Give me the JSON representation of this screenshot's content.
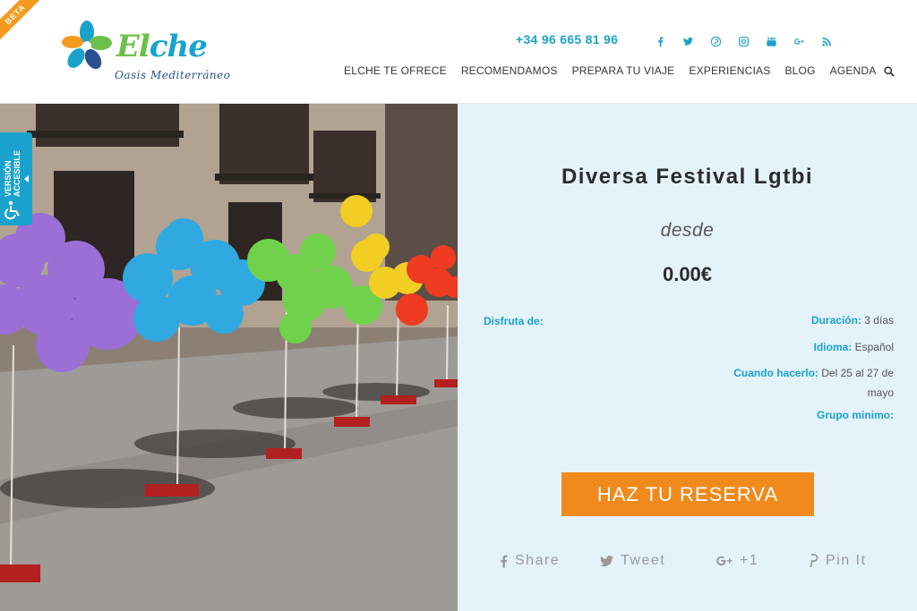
{
  "badge": "BETA",
  "brand": {
    "name_part1": "El",
    "name_part2": "che",
    "tagline": "Oasis Mediterráneo"
  },
  "header": {
    "phone": "+34 96 665 81 96",
    "socials": [
      "facebook-icon",
      "twitter-icon",
      "pinterest-icon",
      "instagram-icon",
      "youtube-icon",
      "google-plus-icon",
      "rss-icon"
    ],
    "nav": [
      "ELCHE TE OFRECE",
      "RECOMENDAMOS",
      "PREPARA TU VIAJE",
      "EXPERIENCIAS",
      "BLOG",
      "AGENDA"
    ]
  },
  "accessible_tab": {
    "label_line1": "VERSIÓN",
    "label_line2": "ACCESIBLE"
  },
  "event": {
    "title": "Diversa Festival Lgtbi",
    "from_label": "desde",
    "price": "0.00€",
    "enjoy_label": "Disfruta de:",
    "duration_label": "Duración:",
    "duration_value": "3 días",
    "language_label": "Idioma:",
    "language_value": "Español",
    "when_label": "Cuando hacerlo:",
    "when_value": "Del 25 al 27 de mayo",
    "group_label": "Grupo minimo:",
    "reserve_button": "HAZ TU RESERVA"
  },
  "share": {
    "facebook": "Share",
    "twitter": "Tweet",
    "gplus": "+1",
    "pinterest": "Pin It"
  },
  "colors": {
    "accent_blue": "#1aa2cc",
    "reserve_orange": "#f08a1c",
    "panel_bg": "#e4f2fa",
    "beta_orange": "#f39a1f"
  }
}
